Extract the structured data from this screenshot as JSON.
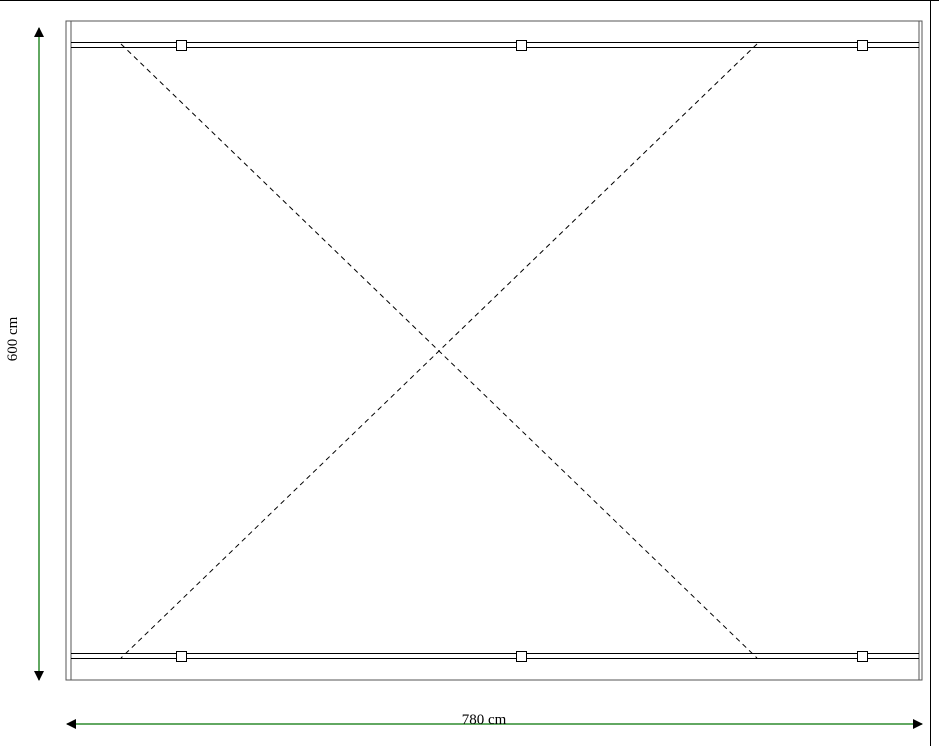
{
  "drawing": {
    "width_label": "780 cm",
    "height_label": "600 cm"
  },
  "colors": {
    "dimension_line": "#2e8b2e",
    "outline": "#000000",
    "background": "#ffffff"
  }
}
